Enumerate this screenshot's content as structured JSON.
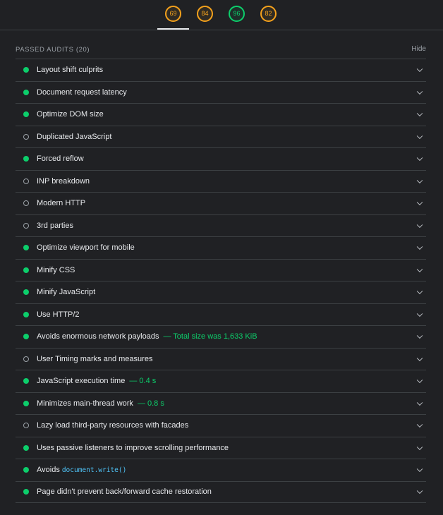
{
  "gauges": [
    {
      "value": "69",
      "color": "orange"
    },
    {
      "value": "84",
      "color": "orange"
    },
    {
      "value": "96",
      "color": "green"
    },
    {
      "value": "82",
      "color": "orange"
    }
  ],
  "section": {
    "title": "PASSED AUDITS (20)",
    "hide_label": "Hide"
  },
  "audits": [
    {
      "title": "Layout shift culprits",
      "status": "pass"
    },
    {
      "title": "Document request latency",
      "status": "pass"
    },
    {
      "title": "Optimize DOM size",
      "status": "pass"
    },
    {
      "title": "Duplicated JavaScript",
      "status": "na"
    },
    {
      "title": "Forced reflow",
      "status": "pass"
    },
    {
      "title": "INP breakdown",
      "status": "na"
    },
    {
      "title": "Modern HTTP",
      "status": "na"
    },
    {
      "title": "3rd parties",
      "status": "na"
    },
    {
      "title": "Optimize viewport for mobile",
      "status": "pass"
    },
    {
      "title": "Minify CSS",
      "status": "pass"
    },
    {
      "title": "Minify JavaScript",
      "status": "pass"
    },
    {
      "title": "Use HTTP/2",
      "status": "pass"
    },
    {
      "title": "Avoids enormous network payloads",
      "status": "pass",
      "display": "— Total size was 1,633 KiB"
    },
    {
      "title": "User Timing marks and measures",
      "status": "na"
    },
    {
      "title": "JavaScript execution time",
      "status": "pass",
      "display": "— 0.4 s"
    },
    {
      "title": "Minimizes main-thread work",
      "status": "pass",
      "display": "— 0.8 s"
    },
    {
      "title": "Lazy load third-party resources with facades",
      "status": "na"
    },
    {
      "title": "Uses passive listeners to improve scrolling performance",
      "status": "pass"
    },
    {
      "title": "Avoids",
      "status": "pass",
      "code": "document.write()"
    },
    {
      "title": "Page didn't prevent back/forward cache restoration",
      "status": "pass"
    }
  ],
  "colors": {
    "pass": "#0cce6b",
    "average": "#f4a11c",
    "background": "#202124"
  },
  "icons": {
    "expand": "chevron-down-icon",
    "pass": "pass-dot-icon",
    "not_applicable": "hollow-circle-icon"
  }
}
